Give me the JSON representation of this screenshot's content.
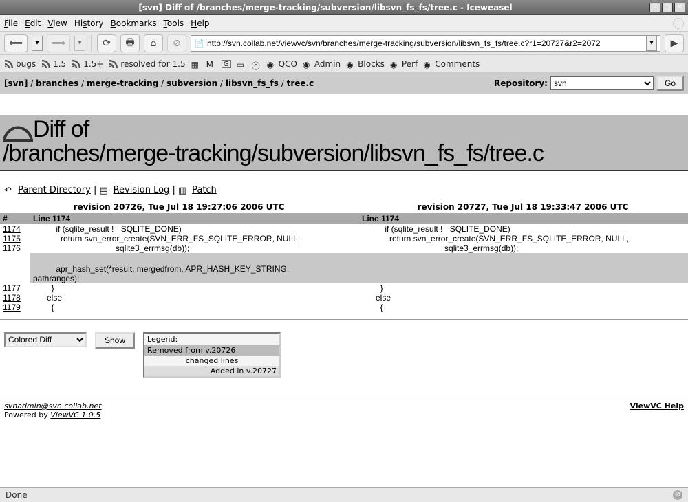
{
  "window": {
    "title": "[svn] Diff of /branches/merge-tracking/subversion/libsvn_fs_fs/tree.c - Iceweasel"
  },
  "menubar": [
    "File",
    "Edit",
    "View",
    "History",
    "Bookmarks",
    "Tools",
    "Help"
  ],
  "url": "http://svn.collab.net/viewvc/svn/branches/merge-tracking/subversion/libsvn_fs_fs/tree.c?r1=20727&r2=2072",
  "bookmarks": [
    "bugs",
    "1.5",
    "1.5+",
    "resolved for 1.5",
    "",
    "M",
    "G",
    "",
    "",
    "QCO",
    "Admin",
    "Blocks",
    "Perf",
    "Comments"
  ],
  "breadcrumb": {
    "parts": [
      "[svn]",
      "branches",
      "merge-tracking",
      "subversion",
      "libsvn_fs_fs",
      "tree.c"
    ],
    "sep": " / "
  },
  "repo": {
    "label": "Repository:",
    "selected": "svn",
    "go": "Go"
  },
  "heading": {
    "line1": "Diff of",
    "line2": "/branches/merge-tracking/subversion/libsvn_fs_fs/tree.c"
  },
  "sublinks": {
    "parent": "Parent Directory",
    "revlog": "Revision Log",
    "patch": "Patch",
    "sep": " | "
  },
  "rev": {
    "left": "revision 20726, Tue Jul 18 19:27:06 2006 UTC",
    "right": "revision 20727, Tue Jul 18 19:33:47 2006 UTC"
  },
  "diff": {
    "hash": "#",
    "line_left": "Line 1174",
    "line_right": "Line 1174",
    "rows": [
      {
        "ln": "1174",
        "l": "          if (sqlite_result != SQLITE_DONE)",
        "r": "          if (sqlite_result != SQLITE_DONE)"
      },
      {
        "ln": "1175",
        "l": "            return svn_error_create(SVN_ERR_FS_SQLITE_ERROR, NULL,",
        "r": "            return svn_error_create(SVN_ERR_FS_SQLITE_ERROR, NULL,"
      },
      {
        "ln": "1176",
        "l": "                                    sqlite3_errmsg(db));",
        "r": "                                    sqlite3_errmsg(db));"
      },
      {
        "ln": "",
        "l": "",
        "r": "",
        "removed": true,
        "blank": true
      },
      {
        "ln": "",
        "l": "          apr_hash_set(*result, mergedfrom, APR_HASH_KEY_STRING,",
        "r": "",
        "removed": true
      },
      {
        "ln": "",
        "l": "pathranges);",
        "r": "",
        "removed": true
      },
      {
        "ln": "1177",
        "l": "        }",
        "r": "        }"
      },
      {
        "ln": "1178",
        "l": "      else",
        "r": "      else"
      },
      {
        "ln": "1179",
        "l": "        {",
        "r": "        {"
      }
    ]
  },
  "controls": {
    "mode": "Colored Diff",
    "show": "Show",
    "legend_title": "Legend:",
    "legend_removed": "Removed from v.20726",
    "legend_changed": "changed lines",
    "legend_added": "Added in v.20727"
  },
  "footer": {
    "email": "svnadmin@svn.collab.net",
    "powered_prefix": "Powered by ",
    "powered_link": "ViewVC 1.0.5",
    "help": "ViewVC Help"
  },
  "status": "Done"
}
